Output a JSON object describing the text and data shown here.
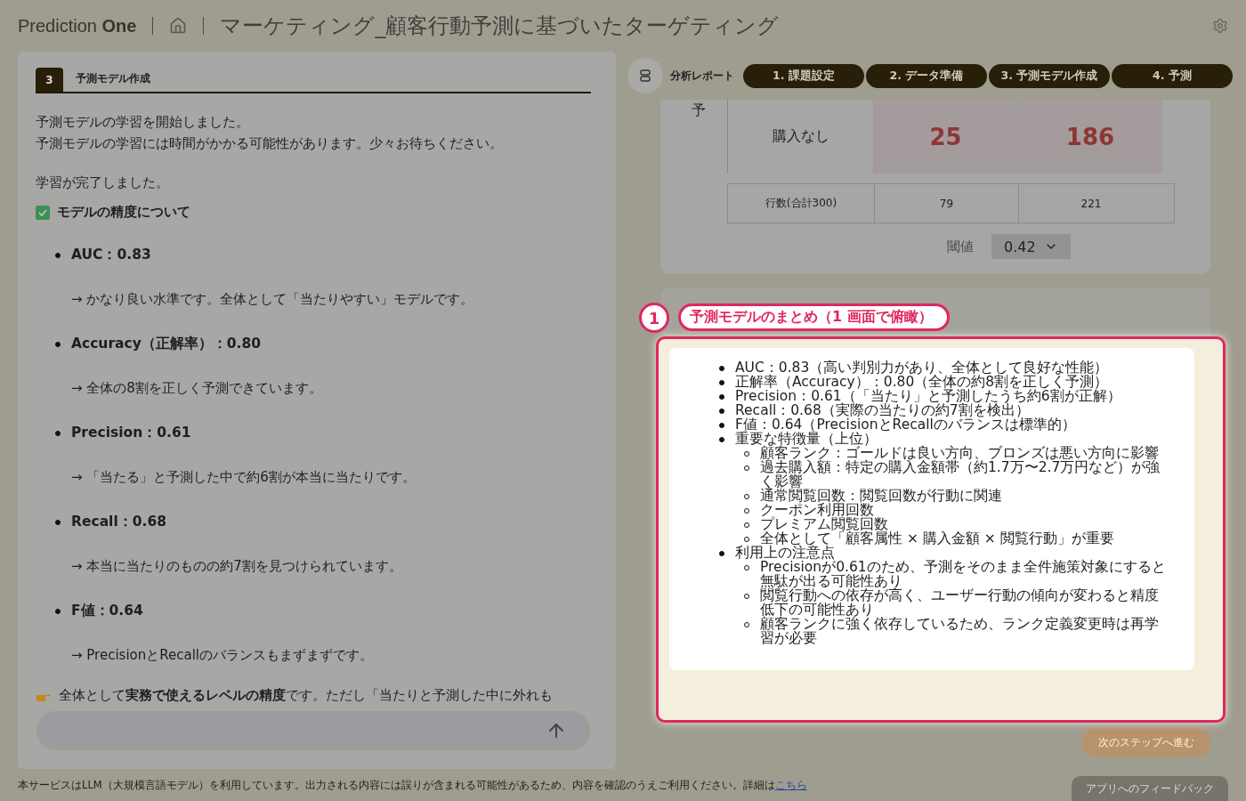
{
  "header": {
    "brand_light": "Prediction",
    "brand_bold": "One",
    "title": "マーケティング_顧客行動予測に基づいたターゲティング"
  },
  "left_panel": {
    "step": {
      "number": "3",
      "title": "予測モデル作成"
    },
    "messages": [
      "予測モデルの学習を開始しました。",
      "予測モデルの学習には時間がかかる可能性があります。少々お待ちください。",
      "学習が完了しました。"
    ],
    "section": {
      "title": "モデルの精度について",
      "checked": true
    },
    "metrics": [
      {
        "label": "AUC：0.83",
        "comment": "→ かなり良い水準です。全体として「当たりやすい」モデルです。"
      },
      {
        "label": "Accuracy（正解率）：0.80",
        "comment": "→ 全体の8割を正しく予測できています。"
      },
      {
        "label": "Precision：0.61",
        "comment": "→ 「当たる」と予測した中で約6割が本当に当たりです。"
      },
      {
        "label": "Recall：0.68",
        "comment": "→ 本当に当たりのものの約7割を見つけられています。"
      },
      {
        "label": "F値：0.64",
        "comment": "→ PrecisionとRecallのバランスもまずまずです。"
      }
    ],
    "conclusion": "全体として**実務で使えるレベルの精度**です。ただし「当たりと予測した中に外れも"
  },
  "right_panel": {
    "report_label": "分析レポート",
    "steps": [
      "1. 課題設定",
      "2. データ準備",
      "3. 予測モデル作成",
      "4. 予測"
    ],
    "matrix": {
      "axis_label": "予",
      "row": {
        "label": "購入なし",
        "values": [
          "25",
          "186"
        ]
      },
      "totals": {
        "label": "行数(合計300)",
        "values": [
          "79",
          "221"
        ]
      }
    },
    "threshold": {
      "label": "閾値",
      "value": "0.42"
    },
    "next_button": "次のステップへ進む"
  },
  "callout": {
    "number": "1",
    "title": "予測モデルのまとめ（1 画面で俯瞰）",
    "items": [
      {
        "text": "AUC：0.83（高い判別力があり、全体として良好な性能）"
      },
      {
        "text": "正解率（Accuracy）：0.80（全体の約8割を正しく予測）"
      },
      {
        "text": "Precision：0.61（「当たり」と予測したうち約6割が正解）"
      },
      {
        "text": "Recall：0.68（実際の当たりの約7割を検出）"
      },
      {
        "text": "F値：0.64（PrecisionとRecallのバランスは標準的）"
      },
      {
        "text": "重要な特徴量（上位）",
        "children": [
          {
            "text": "顧客ランク：ゴールドは良い方向、ブロンズは悪い方向に影響"
          },
          {
            "text": "過去購入額：特定の購入金額帯（約1.7万〜2.7万円など）が強く影響"
          },
          {
            "text": "通常閲覧回数：閲覧回数が行動に関連"
          },
          {
            "text": "クーポン利用回数"
          },
          {
            "text": "プレミアム閲覧回数"
          },
          {
            "text": "全体として「顧客属性 × 購入金額 × 閲覧行動」が重要"
          }
        ]
      },
      {
        "text": "利用上の注意点",
        "children": [
          {
            "text": "Precisionが0.61のため、予測をそのまま全件施策対象にすると無駄が出る可能性あり"
          },
          {
            "text": "閲覧行動への依存が高く、ユーザー行動の傾向が変わると精度低下の可能性あり"
          },
          {
            "text": "顧客ランクに強く依存しているため、ランク定義変更時は再学習が必要"
          }
        ]
      }
    ]
  },
  "footer": {
    "text": "本サービスはLLM（大規模言語モデル）を利用しています。出力される内容には誤りが含まれる可能性があるため、内容を確認のうえご利用ください。詳細は",
    "link": "こちら"
  },
  "feedback_button": "アプリへのフィードバック"
}
